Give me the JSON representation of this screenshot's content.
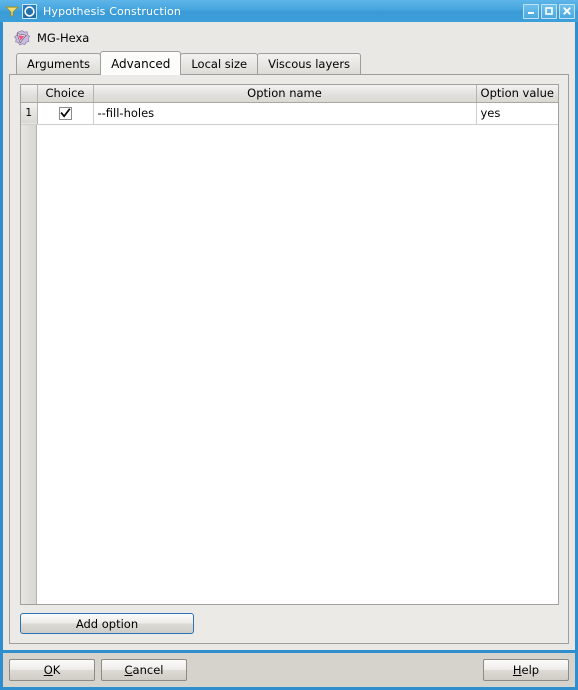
{
  "window": {
    "title": "Hypothesis Construction",
    "left_icon": "mesh-icon",
    "app_icon": "hypothesis-icon",
    "controls": [
      {
        "name": "minimize-button",
        "glyph": "minimize-icon",
        "label": "Minimize"
      },
      {
        "name": "maximize-button",
        "glyph": "maximize-icon",
        "label": "Maximize"
      },
      {
        "name": "close-button",
        "glyph": "close-icon",
        "label": "Close"
      }
    ]
  },
  "hypothesis": {
    "icon": "hexa-mesh-icon",
    "name": "MG-Hexa"
  },
  "tabs": [
    {
      "label": "Arguments",
      "active": false
    },
    {
      "label": "Advanced",
      "active": true
    },
    {
      "label": "Local size",
      "active": false
    },
    {
      "label": "Viscous layers",
      "active": false
    }
  ],
  "table": {
    "columns": [
      "",
      "Choice",
      "Option name",
      "Option value"
    ],
    "rows": [
      {
        "index": "1",
        "choice": true,
        "option_name": "--fill-holes",
        "option_value": "yes"
      }
    ]
  },
  "actions": {
    "add_option": "Add option"
  },
  "footer": {
    "ok": {
      "pre": "",
      "mnemonic": "O",
      "post": "K"
    },
    "cancel": {
      "pre": "",
      "mnemonic": "C",
      "post": "ancel"
    },
    "help": {
      "pre": "",
      "mnemonic": "H",
      "post": "elp"
    }
  },
  "colors": {
    "titlebar_blue": "#3d9fd9",
    "window_frame": "#2f8fce",
    "panel_gray": "#eceae7",
    "focus_blue": "#2a74b5"
  }
}
